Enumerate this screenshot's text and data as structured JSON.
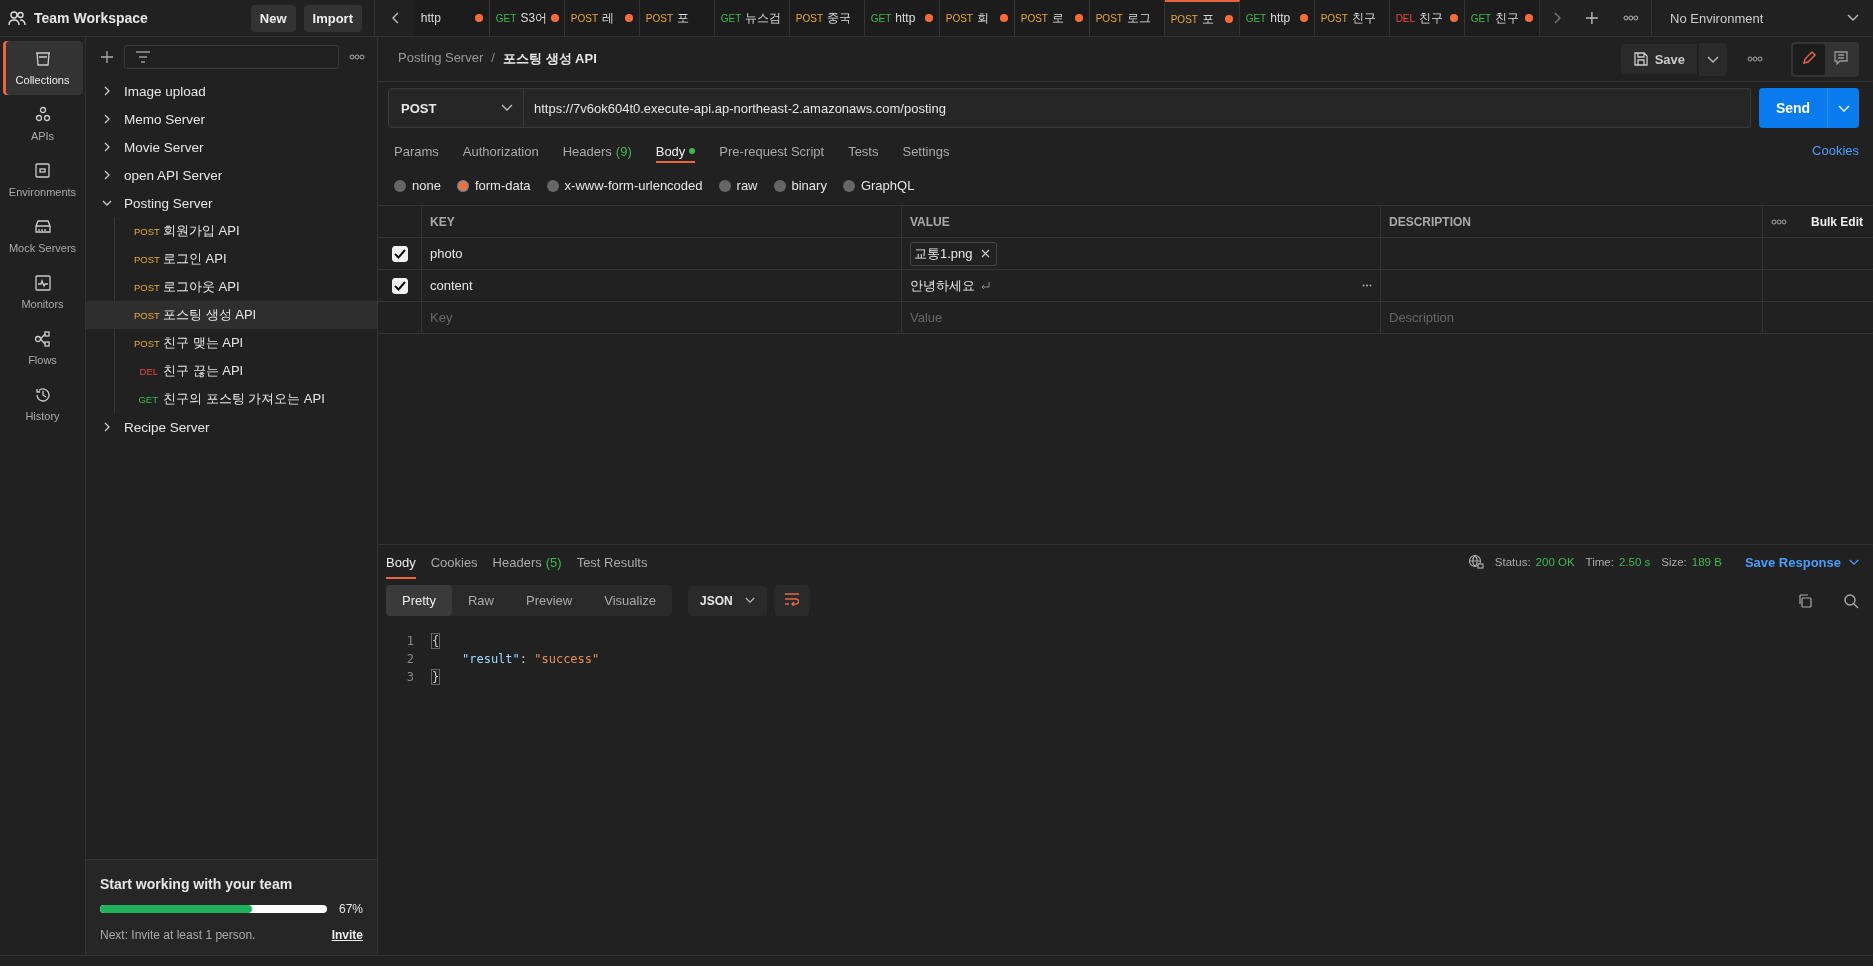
{
  "header": {
    "workspace": "Team Workspace",
    "new_button": "New",
    "import_button": "Import"
  },
  "tabs": [
    {
      "label": "http",
      "unsaved": true,
      "selected": false
    },
    {
      "method": "GET",
      "kind": "get",
      "label": "S3어",
      "unsaved": true,
      "selected": false
    },
    {
      "method": "POST",
      "kind": "post",
      "label": "레",
      "unsaved": true,
      "selected": false
    },
    {
      "method": "POST",
      "kind": "post",
      "label": "포",
      "unsaved": false,
      "selected": false
    },
    {
      "method": "GET",
      "kind": "get",
      "label": "뉴스검",
      "unsaved": false,
      "selected": false
    },
    {
      "method": "POST",
      "kind": "post",
      "label": "중국",
      "unsaved": false,
      "selected": false
    },
    {
      "method": "GET",
      "kind": "get",
      "label": "http",
      "unsaved": true,
      "selected": false
    },
    {
      "method": "POST",
      "kind": "post",
      "label": "회",
      "unsaved": true,
      "selected": false
    },
    {
      "method": "POST",
      "kind": "post",
      "label": "로",
      "unsaved": true,
      "selected": false
    },
    {
      "method": "POST",
      "kind": "post",
      "label": "로그",
      "unsaved": false,
      "selected": false
    },
    {
      "method": "POST",
      "kind": "post",
      "label": "포",
      "unsaved": true,
      "selected": true
    },
    {
      "method": "GET",
      "kind": "get",
      "label": "http",
      "unsaved": true,
      "selected": false
    },
    {
      "method": "POST",
      "kind": "post",
      "label": "친구",
      "unsaved": false,
      "selected": false
    },
    {
      "method": "DEL",
      "kind": "del",
      "label": "친구",
      "unsaved": true,
      "selected": false
    },
    {
      "method": "GET",
      "kind": "get",
      "label": "친구",
      "unsaved": true,
      "selected": false
    }
  ],
  "environment": "No Environment",
  "rail": [
    {
      "label": "Collections",
      "kind": "collections",
      "selected": true
    },
    {
      "label": "APIs",
      "kind": "apis",
      "selected": false
    },
    {
      "label": "Environments",
      "kind": "environments",
      "selected": false
    },
    {
      "label": "Mock Servers",
      "kind": "mock",
      "selected": false
    },
    {
      "label": "Monitors",
      "kind": "monitors",
      "selected": false
    },
    {
      "label": "Flows",
      "kind": "flows",
      "selected": false
    },
    {
      "label": "History",
      "kind": "history",
      "selected": false
    }
  ],
  "tree": [
    {
      "label": "Image upload",
      "expanded": false
    },
    {
      "label": "Memo Server",
      "expanded": false
    },
    {
      "label": "Movie Server",
      "expanded": false
    },
    {
      "label": "open API Server",
      "expanded": false
    },
    {
      "label": "Posting Server",
      "expanded": true,
      "children": [
        {
          "method": "POST",
          "kind": "post",
          "label": "회원가입 API",
          "selected": false
        },
        {
          "method": "POST",
          "kind": "post",
          "label": "로그인 API",
          "selected": false
        },
        {
          "method": "POST",
          "kind": "post",
          "label": "로그아웃 API",
          "selected": false
        },
        {
          "method": "POST",
          "kind": "post",
          "label": "포스팅 생성 API",
          "selected": true
        },
        {
          "method": "POST",
          "kind": "post",
          "label": "친구 맺는 API",
          "selected": false
        },
        {
          "method": "DEL",
          "kind": "del",
          "label": "친구 끊는 API",
          "selected": false
        },
        {
          "method": "GET",
          "kind": "get",
          "label": "친구의 포스팅 가져오는 API",
          "selected": false
        }
      ]
    },
    {
      "label": "Recipe Server",
      "expanded": false
    }
  ],
  "breadcrumb": {
    "parent": "Posting Server",
    "separator": "/",
    "current": "포스팅 생성 API"
  },
  "save_button": "Save",
  "request": {
    "method": "POST",
    "url": "https://7v6ok604t0.execute-api.ap-northeast-2.amazonaws.com/posting",
    "send_button": "Send"
  },
  "request_tabs": [
    {
      "label": "Params",
      "selected": false,
      "dot": false
    },
    {
      "label": "Authorization",
      "selected": false,
      "dot": false
    },
    {
      "label": "Headers",
      "count": "(9)",
      "selected": false,
      "dot": false
    },
    {
      "label": "Body",
      "selected": true,
      "dot": true
    },
    {
      "label": "Pre-request Script",
      "selected": false,
      "dot": false
    },
    {
      "label": "Tests",
      "selected": false,
      "dot": false
    },
    {
      "label": "Settings",
      "selected": false,
      "dot": false
    }
  ],
  "cookies_link": "Cookies",
  "body_modes": [
    {
      "label": "none",
      "selected": false
    },
    {
      "label": "form-data",
      "selected": true
    },
    {
      "label": "x-www-form-urlencoded",
      "selected": false
    },
    {
      "label": "raw",
      "selected": false
    },
    {
      "label": "binary",
      "selected": false
    },
    {
      "label": "GraphQL",
      "selected": false
    }
  ],
  "params_table": {
    "columns": [
      "KEY",
      "VALUE",
      "DESCRIPTION"
    ],
    "bulk_edit": "Bulk Edit",
    "rows": [
      {
        "checked": true,
        "key": "photo",
        "kind": "file",
        "value": "교통1.png"
      },
      {
        "checked": true,
        "key": "content",
        "kind": "text",
        "value": "안녕하세요"
      }
    ],
    "new_row": [
      {
        "placeholder": "Key"
      },
      {
        "placeholder": "Value"
      },
      {
        "placeholder": "Description"
      }
    ]
  },
  "response": {
    "tabs": [
      {
        "label": "Body",
        "selected": true
      },
      {
        "label": "Cookies",
        "selected": false
      },
      {
        "label": "Headers",
        "count": "(5)",
        "selected": false
      },
      {
        "label": "Test Results",
        "selected": false
      }
    ],
    "status_label": "Status:",
    "status": "200 OK",
    "time_label": "Time:",
    "time": "2.50 s",
    "size_label": "Size:",
    "size": "189 B",
    "save_response": "Save Response",
    "views": [
      {
        "label": "Pretty",
        "selected": true
      },
      {
        "label": "Raw",
        "selected": false
      },
      {
        "label": "Preview",
        "selected": false
      },
      {
        "label": "Visualize",
        "selected": false
      }
    ],
    "format": "JSON",
    "lines": [
      {
        "number": "1",
        "kind": "bracket",
        "text": "{"
      },
      {
        "number": "2",
        "kind": "pair",
        "key": "\"result\"",
        "sep": ": ",
        "value": "\"success\""
      },
      {
        "number": "3",
        "kind": "bracket",
        "text": "}"
      }
    ]
  },
  "onboarding": {
    "title": "Start working with your team",
    "level": 0.67,
    "percent": "67%",
    "next": "Next: Invite at least 1 person.",
    "invite": "Invite"
  }
}
